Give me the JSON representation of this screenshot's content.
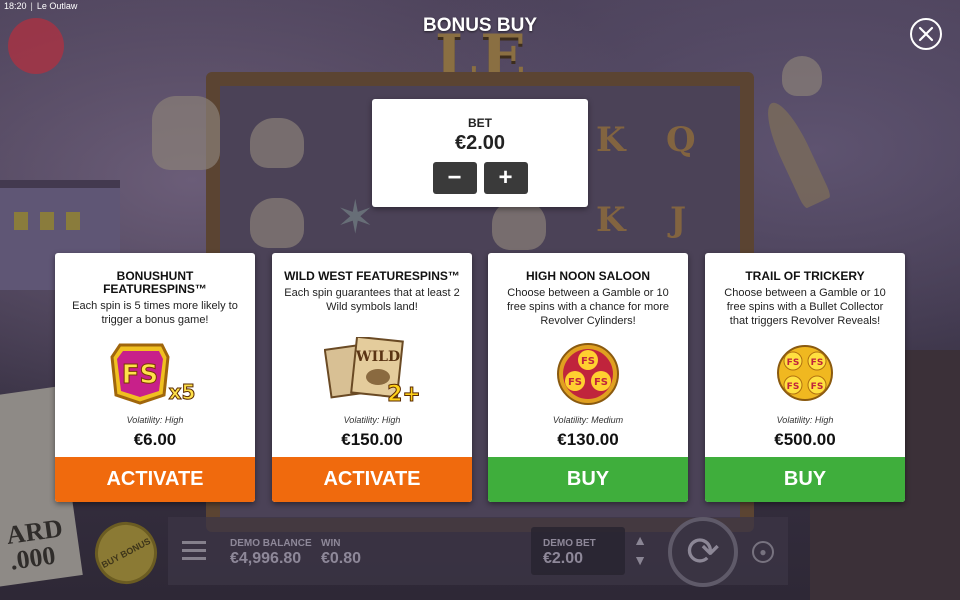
{
  "status_bar": {
    "time": "18:20",
    "separator": "|",
    "app_name": "Le Outlaw"
  },
  "background": {
    "logo_text": "LE OUTLAW",
    "poster_text": "ARD\n.000"
  },
  "overlay": {
    "title": "BONUS BUY",
    "close_icon": "close-icon"
  },
  "bet": {
    "label": "BET",
    "value": "€2.00",
    "minus": "−",
    "plus": "+"
  },
  "cards": [
    {
      "title": "BONUSHUNT FEATURESPINS™",
      "description": "Each spin is 5 times more likely to trigger a bonus game!",
      "icon": "fs-x5-icon",
      "icon_text": "FS",
      "icon_multiplier": "x5",
      "volatility": "Volatility: High",
      "price": "€6.00",
      "action": "ACTIVATE",
      "action_color": "#f06a0d"
    },
    {
      "title": "WILD WEST FEATURESPINS™",
      "description": "Each spin guarantees that at least 2 Wild symbols land!",
      "icon": "wild-posters-icon",
      "icon_text": "WILD",
      "icon_multiplier": "2+",
      "volatility": "Volatility: High",
      "price": "€150.00",
      "action": "ACTIVATE",
      "action_color": "#f06a0d"
    },
    {
      "title": "HIGH NOON SALOON",
      "description": "Choose between a Gamble or 10 free spins with a chance for more Revolver Cylinders!",
      "icon": "revolver-cylinder-red-icon",
      "icon_text": "FS",
      "volatility": "Volatility: Medium",
      "price": "€130.00",
      "action": "BUY",
      "action_color": "#3fae3c"
    },
    {
      "title": "TRAIL OF TRICKERY",
      "description": "Choose between a Gamble or 10 free spins with a Bullet Collector that triggers Revolver Reveals!",
      "icon": "revolver-cylinder-gold-icon",
      "icon_text": "FS",
      "volatility": "Volatility: High",
      "price": "€500.00",
      "action": "BUY",
      "action_color": "#3fae3c"
    }
  ],
  "hud": {
    "buy_bonus": "BUY BONUS",
    "demo_balance_label": "DEMO BALANCE",
    "demo_balance_value": "€4,996.80",
    "win_label": "WIN",
    "win_value": "€0.80",
    "demo_bet_label": "DEMO BET",
    "demo_bet_value": "€2.00"
  }
}
